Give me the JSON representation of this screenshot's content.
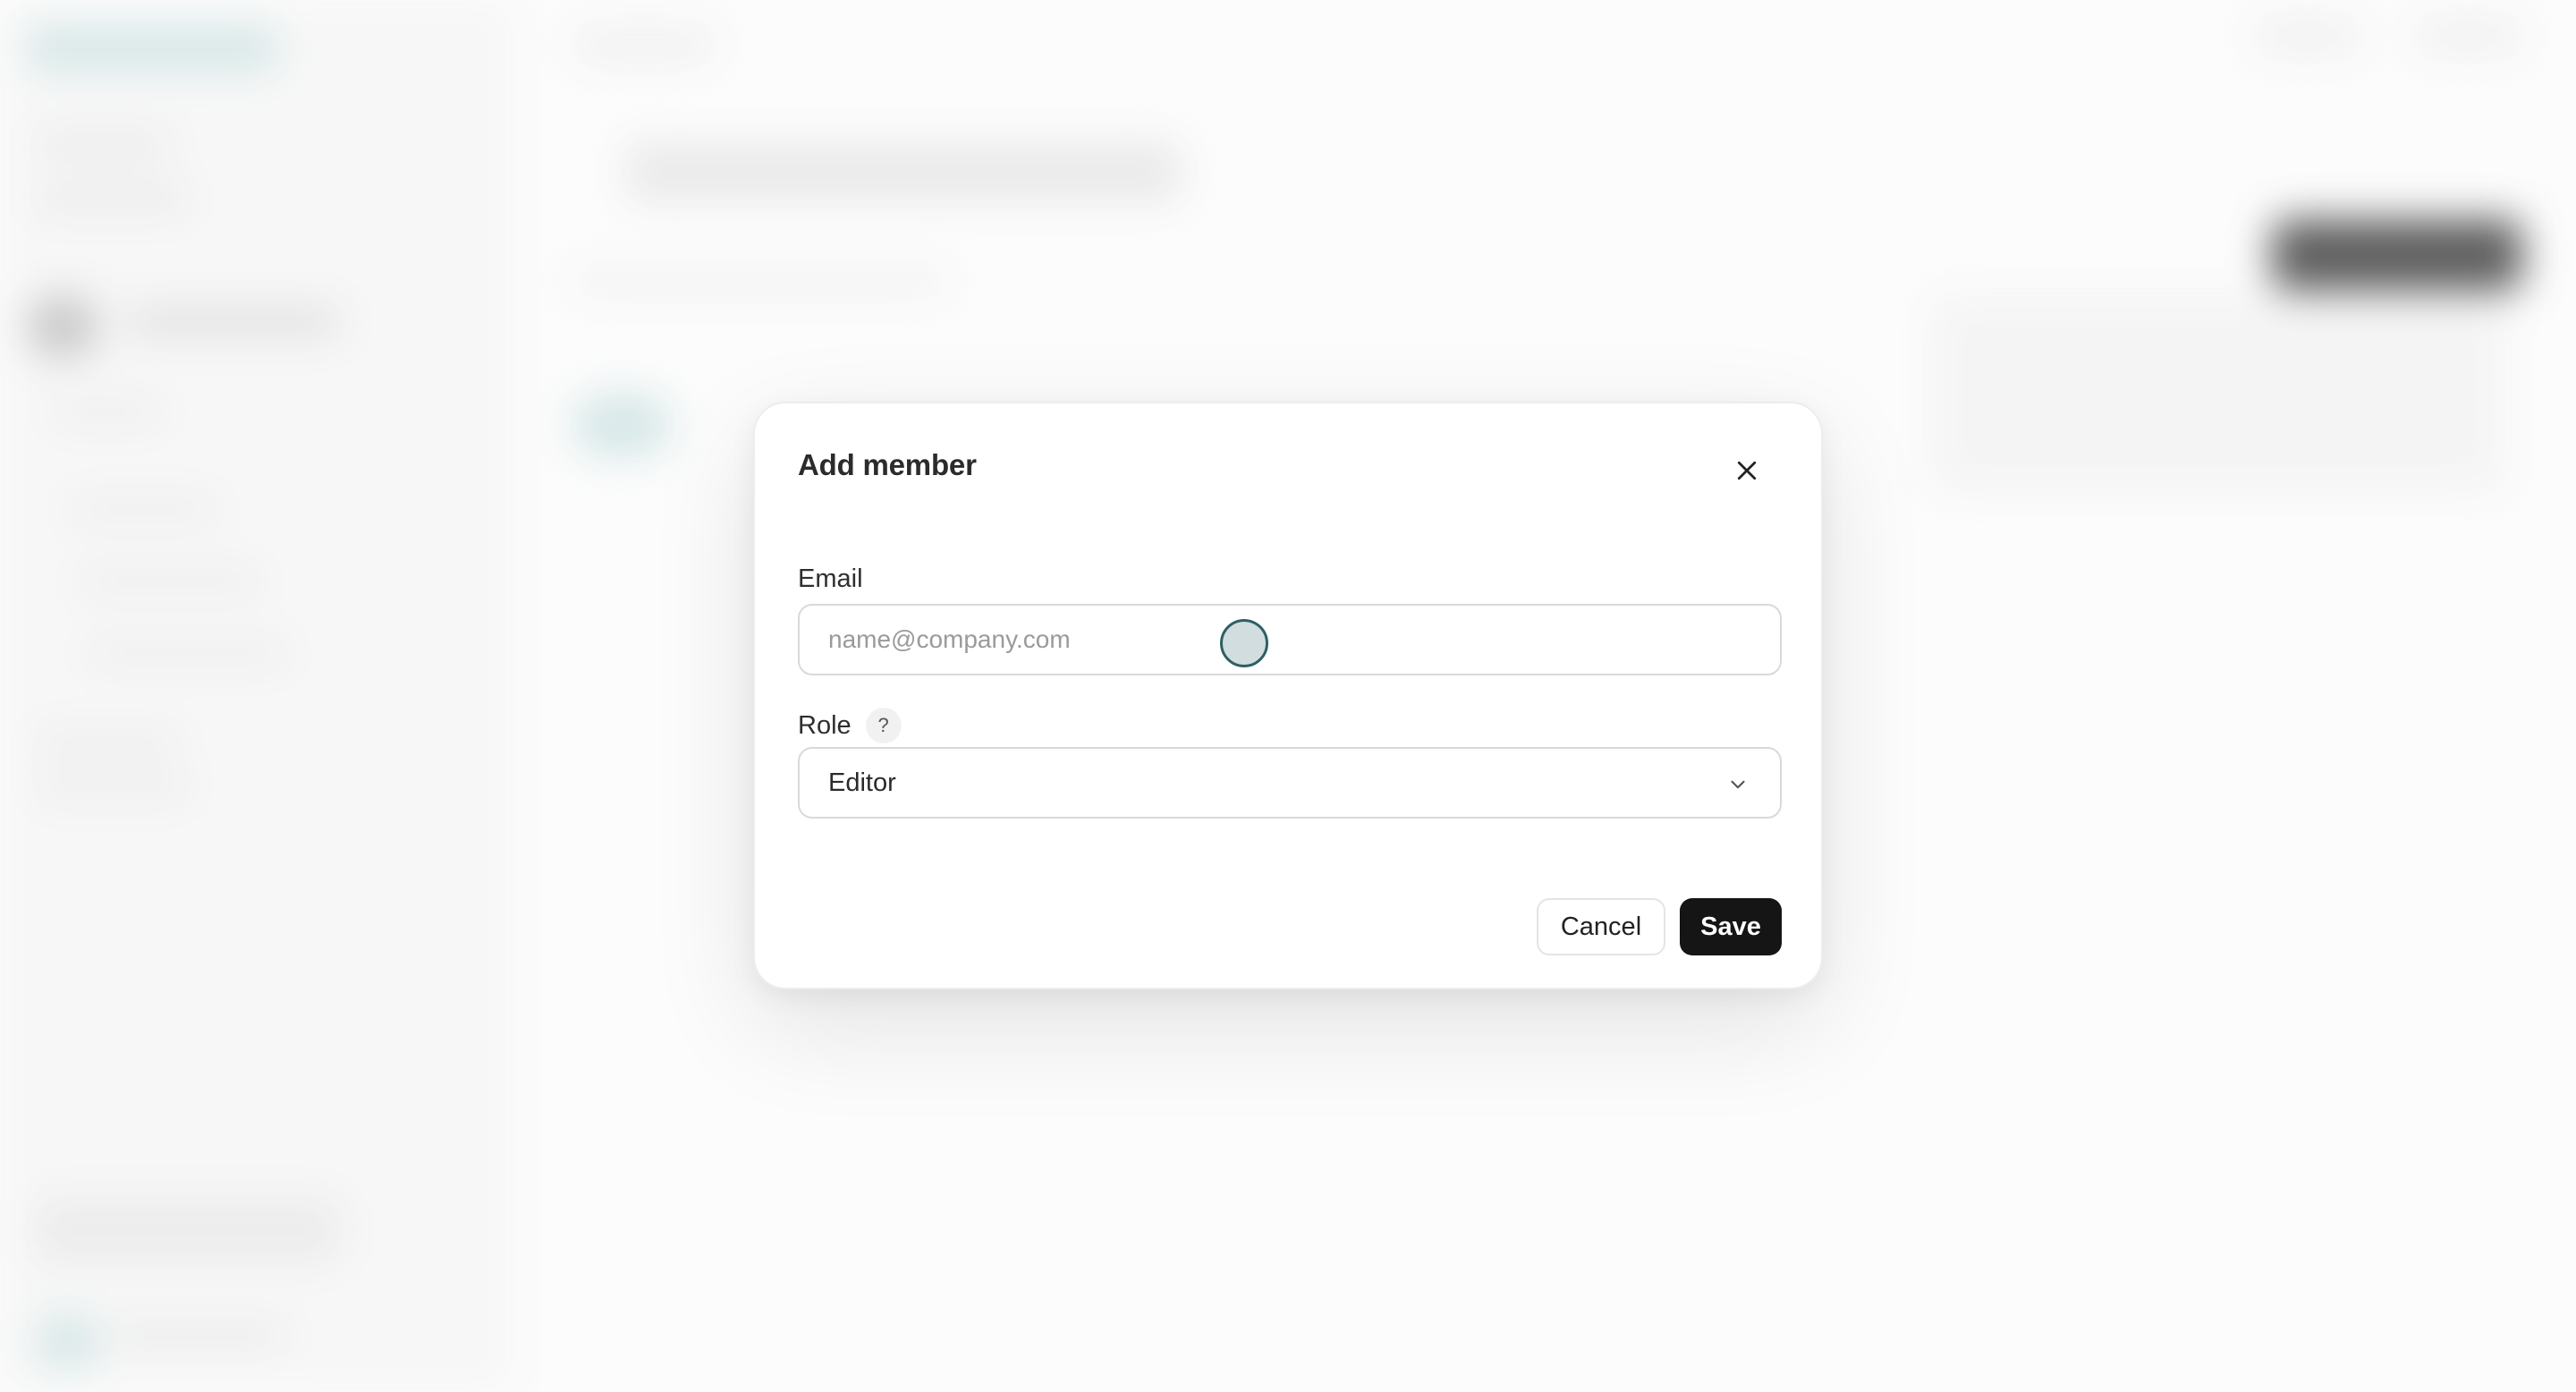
{
  "dialog": {
    "title": "Add member",
    "close_icon": "close-icon"
  },
  "email": {
    "label": "Email",
    "value": "",
    "placeholder": "name@company.com"
  },
  "role": {
    "label": "Role",
    "help_glyph": "?",
    "selected": "Editor",
    "chevron_icon": "chevron-down-icon"
  },
  "actions": {
    "cancel_label": "Cancel",
    "save_label": "Save"
  },
  "colors": {
    "primary": "#151515",
    "cursor_ring": "#2f5f63"
  }
}
